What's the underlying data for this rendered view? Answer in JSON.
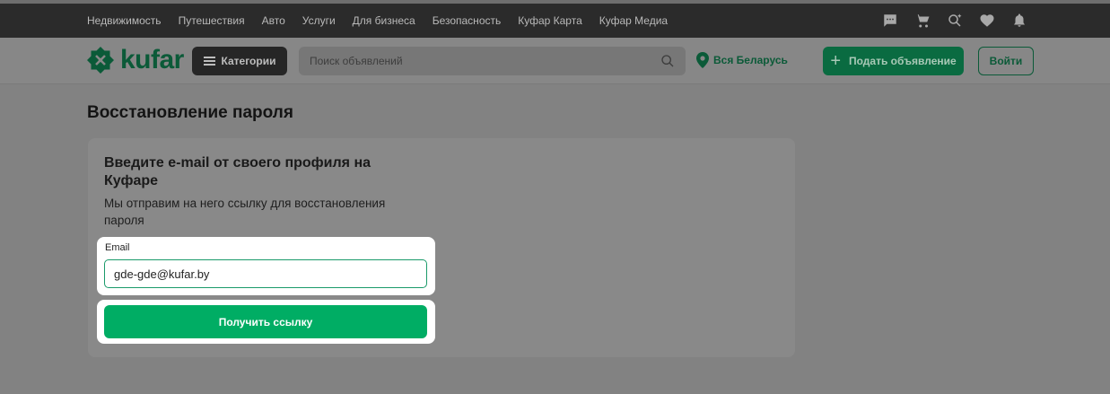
{
  "topnav": {
    "links": [
      "Недвижимость",
      "Путешествия",
      "Авто",
      "Услуги",
      "Для бизнеса",
      "Безопасность",
      "Куфар Карта",
      "Куфар Медиа"
    ],
    "icons": [
      "chat-icon",
      "cart-icon",
      "saved-search-icon",
      "heart-icon",
      "bell-icon"
    ]
  },
  "header": {
    "logo_text": "kufar",
    "categories_label": "Категории",
    "search_placeholder": "Поиск объявлений",
    "region_label": "Вся Беларусь",
    "post_ad_label": "Подать объявление",
    "login_label": "Войти"
  },
  "page": {
    "title": "Восстановление пароля"
  },
  "form": {
    "heading": "Введите e-mail от своего профиля на Куфаре",
    "description": "Мы отправим на него ссылку для восстановления пароля",
    "email_label": "Email",
    "email_value": "gde-gde@kufar.by",
    "submit_label": "Получить ссылку"
  },
  "colors": {
    "brand_green": "#00ad64",
    "dark_green": "#0b5a38",
    "topbar": "#2b2b2b"
  }
}
